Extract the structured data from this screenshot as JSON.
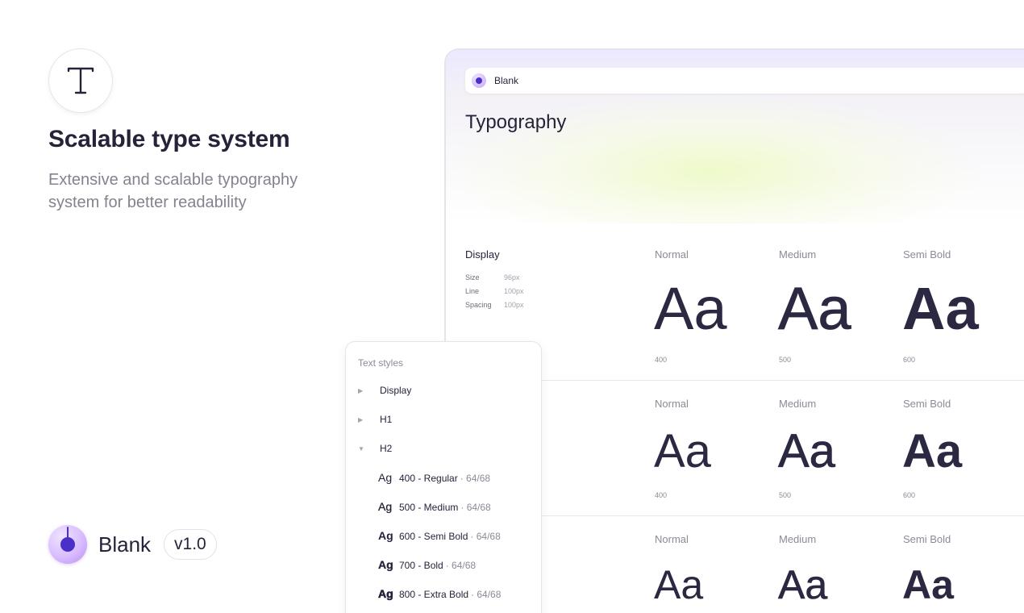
{
  "hero": {
    "icon": "type-t-icon",
    "title": "Scalable type system",
    "subtitle": "Extensive and scalable typography system for better readability"
  },
  "brand": {
    "name": "Blank",
    "version": "v1.0"
  },
  "window": {
    "topbar_label": "Blank",
    "page_title": "Typography",
    "display_section": {
      "label": "Display",
      "meta": [
        {
          "key": "Size",
          "value": "96px"
        },
        {
          "key": "Line",
          "value": "100px"
        },
        {
          "key": "Spacing",
          "value": "100px"
        }
      ]
    },
    "columns": [
      "Normal",
      "Medium",
      "Semi Bold"
    ],
    "rows": [
      {
        "sample": "Aa",
        "weights": [
          "400",
          "500",
          "600"
        ]
      },
      {
        "sample": "Aa",
        "weights": [
          "400",
          "500",
          "600"
        ]
      },
      {
        "sample": "Aa",
        "weights": []
      }
    ]
  },
  "panel": {
    "title": "Text styles",
    "groups": [
      {
        "label": "Display",
        "expanded": false
      },
      {
        "label": "H1",
        "expanded": false
      },
      {
        "label": "H2",
        "expanded": true
      }
    ],
    "styles": [
      {
        "ag": "Ag",
        "name": "400 - Regular",
        "dim": "· 64/68"
      },
      {
        "ag": "Ag",
        "name": "500 - Medium",
        "dim": "· 64/68"
      },
      {
        "ag": "Ag",
        "name": "600 - Semi Bold",
        "dim": "· 64/68"
      },
      {
        "ag": "Ag",
        "name": "700 - Bold",
        "dim": "· 64/68"
      },
      {
        "ag": "Ag",
        "name": "800 - Extra Bold",
        "dim": "· 64/68"
      }
    ]
  },
  "colors": {
    "text": "#25233a",
    "muted": "#83838f",
    "accent": "#4a2fc9"
  }
}
